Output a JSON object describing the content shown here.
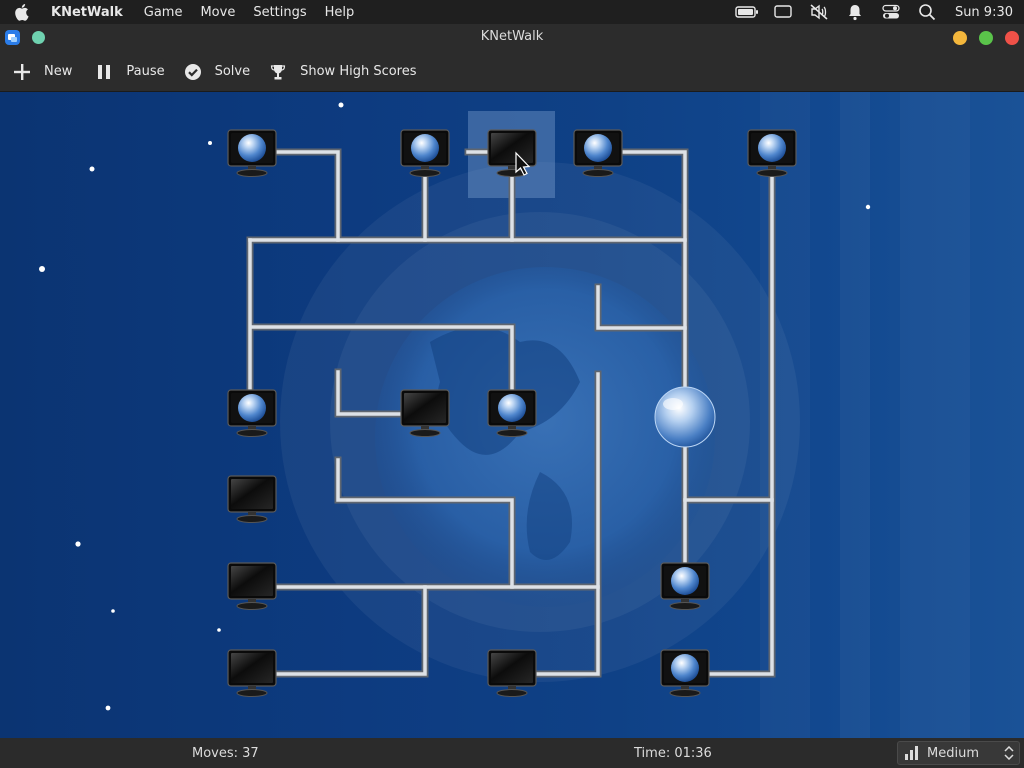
{
  "menubar": {
    "app_name": "KNetWalk",
    "menus": [
      "Game",
      "Move",
      "Settings",
      "Help"
    ],
    "clock": "Sun 9:30"
  },
  "window": {
    "title": "KNetWalk"
  },
  "toolbar": {
    "new_label": "New",
    "pause_label": "Pause",
    "solve_label": "Solve",
    "high_scores_label": "Show High Scores"
  },
  "status": {
    "moves": "Moves: 37",
    "time": "Time: 01:36",
    "difficulty": "Medium"
  },
  "colors": {
    "menubar_bg": "#1f1f1f",
    "toolbar_bg": "#2c2c2c",
    "board_bg": "#0d3b80",
    "cable": "#c9ccd2",
    "minimize": "#f4b73c",
    "maximize": "#5ac34a",
    "close": "#ef5148"
  }
}
